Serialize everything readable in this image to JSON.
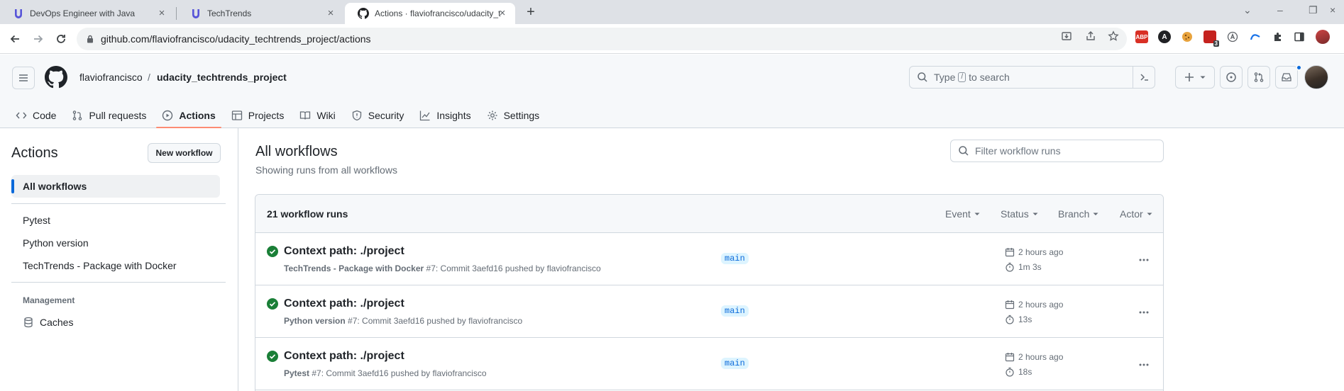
{
  "browser": {
    "tabs": [
      {
        "title": "DevOps Engineer with Java",
        "icon": "udacity-icon",
        "active": false
      },
      {
        "title": "TechTrends",
        "icon": "udacity-icon",
        "active": false
      },
      {
        "title": "Actions · flaviofrancisco/udacity_t",
        "icon": "github-icon",
        "active": true
      }
    ],
    "url": "github.com/flaviofrancisco/udacity_techtrends_project/actions",
    "extension_badge": "3",
    "extensions": [
      "ABP",
      "A"
    ]
  },
  "header": {
    "owner": "flaviofrancisco",
    "separator": "/",
    "repo": "udacity_techtrends_project",
    "search_prefix": "Type",
    "search_key": "/",
    "search_suffix": "to search"
  },
  "repo_nav": [
    {
      "label": "Code",
      "icon": "code-icon"
    },
    {
      "label": "Pull requests",
      "icon": "pull-request-icon"
    },
    {
      "label": "Actions",
      "icon": "play-icon",
      "active": true
    },
    {
      "label": "Projects",
      "icon": "table-icon"
    },
    {
      "label": "Wiki",
      "icon": "book-icon"
    },
    {
      "label": "Security",
      "icon": "shield-icon"
    },
    {
      "label": "Insights",
      "icon": "graph-icon"
    },
    {
      "label": "Settings",
      "icon": "gear-icon"
    }
  ],
  "sidebar": {
    "title": "Actions",
    "new_workflow": "New workflow",
    "all_workflows": "All workflows",
    "workflows": [
      "Pytest",
      "Python version",
      "TechTrends - Package with Docker"
    ],
    "management_heading": "Management",
    "caches": "Caches"
  },
  "main": {
    "title": "All workflows",
    "subtitle": "Showing runs from all workflows",
    "filter_placeholder": "Filter workflow runs",
    "runs_count": "21 workflow runs",
    "filters": [
      "Event",
      "Status",
      "Branch",
      "Actor"
    ],
    "runs": [
      {
        "title": "Context path: ./project",
        "workflow": "TechTrends - Package with Docker",
        "meta": " #7: Commit 3aefd16 pushed by flaviofrancisco",
        "branch": "main",
        "when": "2 hours ago",
        "duration": "1m 3s",
        "status": "success"
      },
      {
        "title": "Context path: ./project",
        "workflow": "Python version",
        "meta": " #7: Commit 3aefd16 pushed by flaviofrancisco",
        "branch": "main",
        "when": "2 hours ago",
        "duration": "13s",
        "status": "success"
      },
      {
        "title": "Context path: ./project",
        "workflow": "Pytest",
        "meta": " #7: Commit 3aefd16 pushed by flaviofrancisco",
        "branch": "main",
        "when": "2 hours ago",
        "duration": "18s",
        "status": "success"
      }
    ]
  },
  "colors": {
    "accent": "#0969da",
    "success": "#1a7f37",
    "underline": "#fd8c73",
    "udacity": "#5754d8"
  }
}
